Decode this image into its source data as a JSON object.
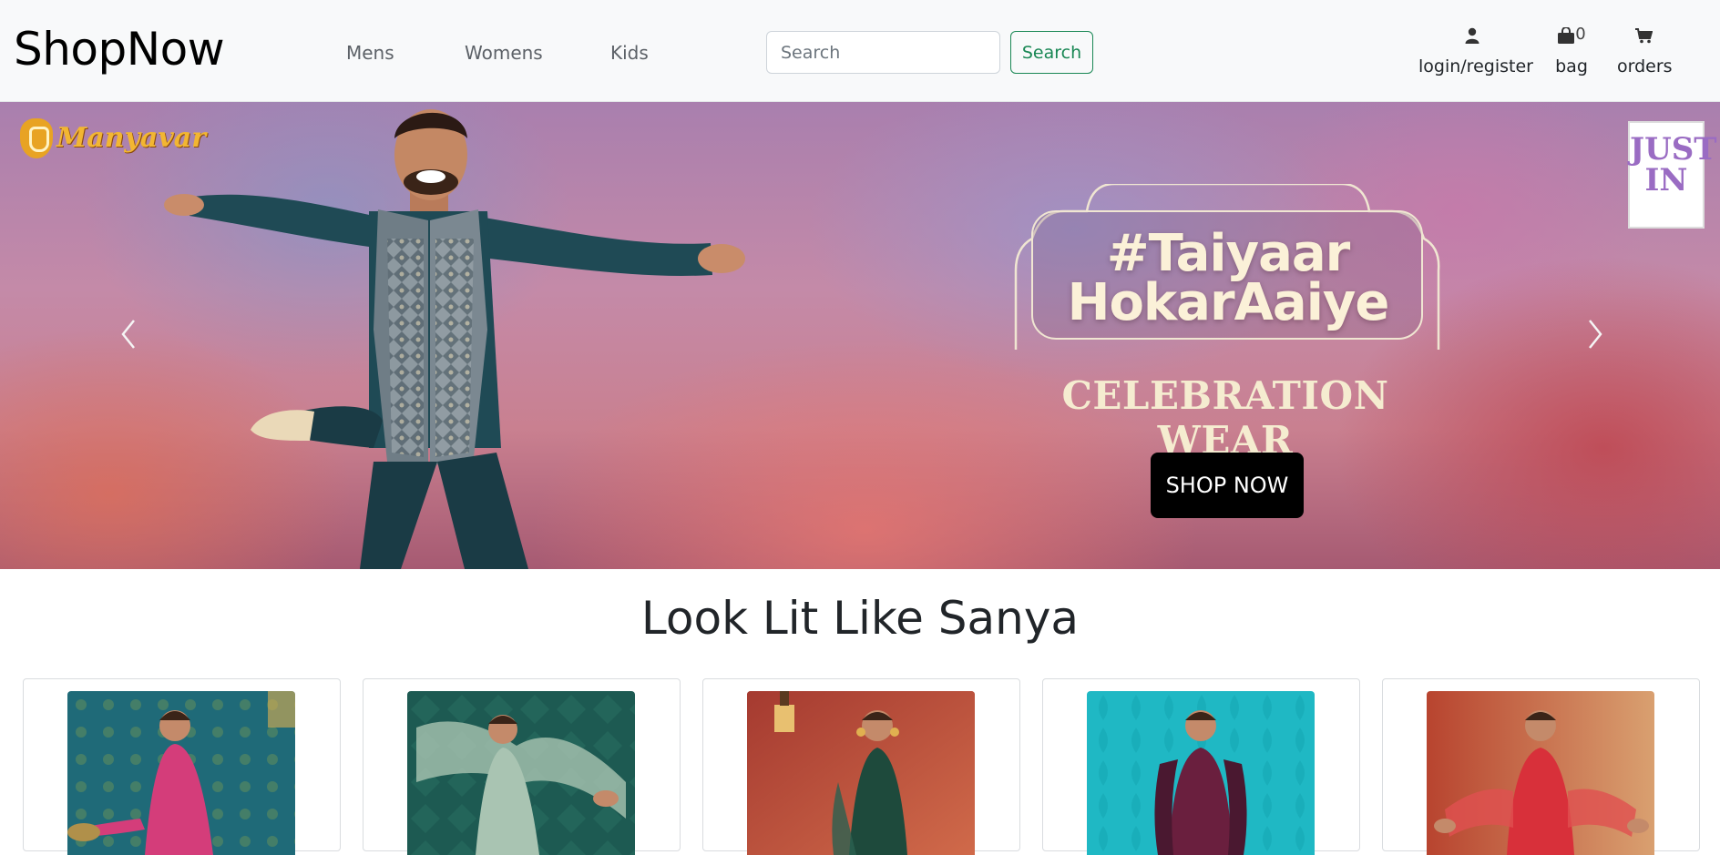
{
  "navbar": {
    "brand": "ShopNow",
    "links": [
      {
        "label": "Mens"
      },
      {
        "label": "Womens"
      },
      {
        "label": "Kids"
      }
    ],
    "search": {
      "placeholder": "Search",
      "button_label": "Search"
    },
    "user_menu": {
      "login_label": "login/register",
      "bag_label": "bag",
      "bag_count": "0",
      "orders_label": "orders"
    }
  },
  "carousel": {
    "logo_text": "Manyavar",
    "badge_text": [
      "JUST",
      "IN"
    ],
    "headline": [
      "#Taiyaar",
      "HokarAaiye"
    ],
    "subheadline": "CELEBRATION WEAR",
    "cta_label": "SHOP NOW",
    "prev_icon": "chevron-left-icon",
    "next_icon": "chevron-right-icon"
  },
  "section": {
    "title": "Look Lit Like Sanya",
    "products": [
      {
        "color": "#1f6a78",
        "dress": "#d43d7a"
      },
      {
        "color": "#1d5a52",
        "dress": "#a9c4b2"
      },
      {
        "color": "#b54a3a",
        "dress": "#1e4a3c"
      },
      {
        "color": "#1fb8c4",
        "dress": "#6a1f3e"
      },
      {
        "color": "#c9543f",
        "dress": "#d8303a"
      }
    ]
  },
  "colors": {
    "accent": "#198754",
    "navbar_bg": "#f8f9fa",
    "cta_bg": "#000000"
  }
}
